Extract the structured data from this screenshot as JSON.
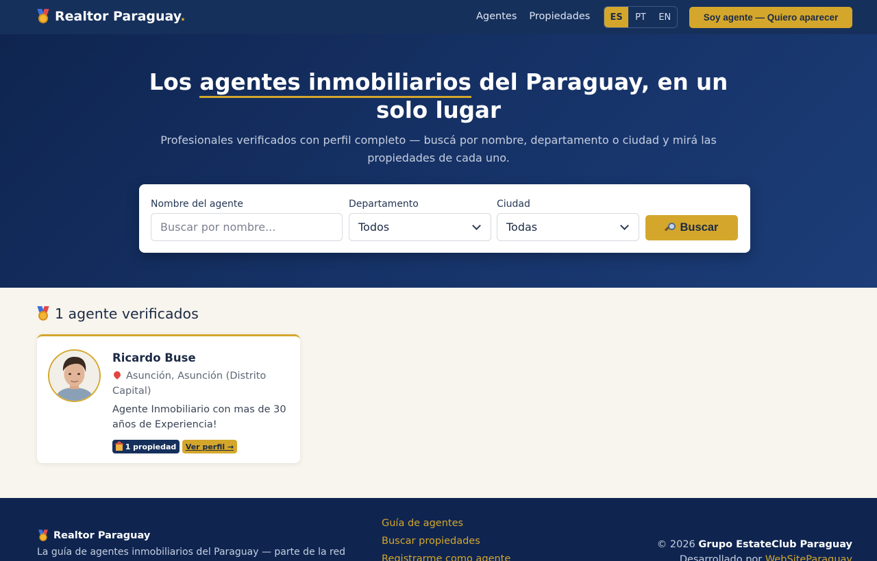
{
  "header": {
    "brand_name": "Realtor Paraguay",
    "brand_dot": ".",
    "nav": [
      "Agentes",
      "Propiedades"
    ],
    "languages": [
      "ES",
      "PT",
      "EN"
    ],
    "active_language": "ES",
    "cta_label": "Soy agente — Quiero aparecer"
  },
  "hero": {
    "title_pre": "Los ",
    "title_highlight": "agentes inmobiliarios",
    "title_post": " del Paraguay, en un solo lugar",
    "subtitle": "Profesionales verificados con perfil completo — buscá por nombre, departamento o ciudad y mirá las propiedades de cada uno."
  },
  "search": {
    "name_label": "Nombre del agente",
    "name_placeholder": "Buscar por nombre...",
    "department_label": "Departamento",
    "department_value": "Todos",
    "city_label": "Ciudad",
    "city_value": "Todas",
    "button_label": "Buscar"
  },
  "results": {
    "count_label": "1 agente verificados"
  },
  "agents": [
    {
      "name": "Ricardo Buse",
      "location": "Asunción, Asunción (Distrito Capital)",
      "bio": "Agente Inmobiliario con mas de 30 años de Experiencia!",
      "properties_badge": "1 propiedad",
      "profile_link": "Ver perfil →"
    }
  ],
  "footer": {
    "brand_name": "Realtor Paraguay",
    "description": "La guía de agentes inmobiliarios del Paraguay — parte de la red",
    "links": [
      "Guía de agentes",
      "Buscar propiedades",
      "Registrarme como agente"
    ],
    "copyright_prefix": "© 2026 ",
    "copyright_owner": "Grupo EstateClub Paraguay",
    "developed_prefix": "Desarrollado por ",
    "developer": "WebSiteParaguay"
  },
  "colors": {
    "navy": "#16305c",
    "gold": "#d4a72c",
    "cream": "#f8f5ee"
  }
}
